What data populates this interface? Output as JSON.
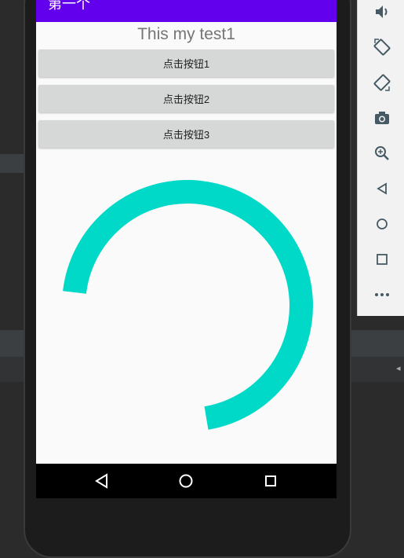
{
  "app_bar": {
    "title": "第一个",
    "color": "#6200ee"
  },
  "screen": {
    "heading": "This my test1",
    "buttons": [
      {
        "label": "点击按钮1"
      },
      {
        "label": "点击按钮2"
      },
      {
        "label": "点击按钮3"
      }
    ],
    "progress_ring": {
      "color": "#00d9c7"
    }
  },
  "nav_bar": {
    "icons": [
      "back-triangle-icon",
      "home-circle-icon",
      "recents-square-icon"
    ]
  },
  "emulator_toolbar": {
    "tools": [
      "volume-icon",
      "rotate-left-icon",
      "rotate-right-icon",
      "camera-icon",
      "zoom-in-icon",
      "back-icon",
      "home-icon",
      "overview-icon",
      "more-icon"
    ]
  }
}
